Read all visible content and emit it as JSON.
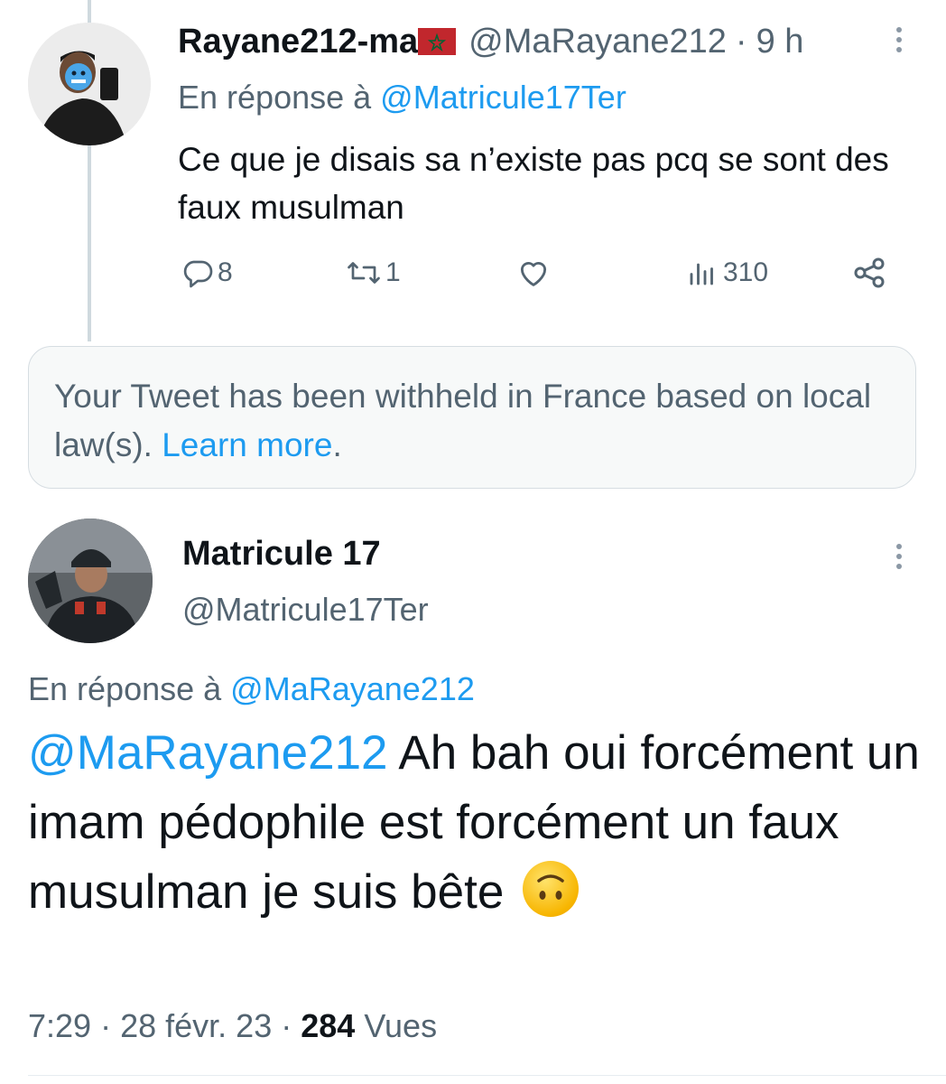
{
  "tweet1": {
    "display_name": "Rayane212-ma",
    "flag_icon": "morocco-flag-icon",
    "handle": "@MaRayane212",
    "separator": "·",
    "time": "9 h",
    "reply_prefix": "En réponse à",
    "reply_handle": "@Matricule17Ter",
    "text": "Ce que je disais sa n’existe pas pcq se sont des faux musulman",
    "actions": {
      "replies": "8",
      "retweets": "1",
      "likes": "",
      "views": "310"
    }
  },
  "withheld_notice": {
    "text": "Your Tweet has been withheld in France based on local law(s).",
    "link": "Learn more",
    "suffix": "."
  },
  "tweet2": {
    "display_name": "Matricule 17",
    "handle": "@Matricule17Ter",
    "reply_prefix": "En réponse à",
    "reply_handle": "@MaRayane212",
    "mention": "@MaRayane212",
    "text": "Ah bah oui forcément un imam pédophile est forcément un faux musulman je suis bête",
    "emoji": "upside-down-face-emoji",
    "time": "7:29",
    "separator": "·",
    "date": "28 févr. 23",
    "views_count": "284",
    "views_label": "Vues"
  },
  "colors": {
    "link_blue": "#1d9bf0",
    "secondary_grey": "#536471",
    "text_black": "#0f1419"
  }
}
